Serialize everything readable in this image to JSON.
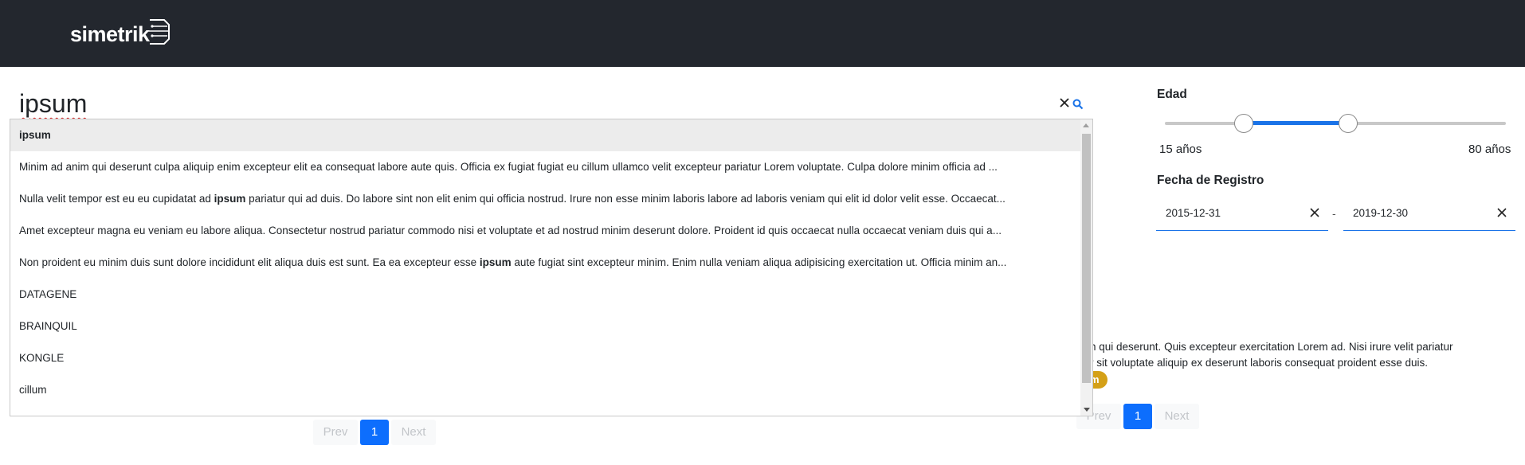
{
  "brand": {
    "logo_text": "simetrik"
  },
  "search": {
    "value": "ipsum"
  },
  "dropdown": {
    "items": [
      {
        "text": "ipsum",
        "active": true
      },
      {
        "parts": [
          "Minim ad anim qui deserunt culpa aliquip enim excepteur elit ea consequat labore aute quis. Officia ex fugiat fugiat eu cillum ullamco velit excepteur pariatur Lorem voluptate. Culpa dolore minim officia ad ..."
        ]
      },
      {
        "parts": [
          "Nulla velit tempor est eu eu cupidatat ad ",
          "ipsum",
          " pariatur qui ad duis. Do labore sint non elit enim qui officia nostrud. Irure non esse minim laboris labore ad laboris veniam qui elit id dolor velit esse. Occaecat..."
        ]
      },
      {
        "parts": [
          "Amet excepteur magna eu veniam eu labore aliqua. Consectetur nostrud pariatur commodo nisi et voluptate et ad nostrud minim deserunt dolore. Proident id quis occaecat nulla occaecat veniam duis qui a..."
        ]
      },
      {
        "parts": [
          "Non proident eu minim duis sunt dolore incididunt elit aliqua duis est sunt. Ea ea excepteur esse ",
          "ipsum",
          " aute fugiat sint excepteur minim. Enim nulla veniam aliqua adipisicing exercitation ut. Officia minim an..."
        ]
      },
      {
        "text": "DATAGENE"
      },
      {
        "text": "BRAINQUIL"
      },
      {
        "text": "KONGLE"
      },
      {
        "text": "cillum"
      }
    ]
  },
  "background_result": {
    "line1": "n qui deserunt. Quis excepteur exercitation Lorem ad. Nisi irure velit pariatur",
    "line2": "r sit voluptate aliquip ex deserunt laboris consequat proident esse duis.",
    "badge": "m"
  },
  "pagination_left": {
    "prev": "Prev",
    "page": "1",
    "next": "Next"
  },
  "pagination_right": {
    "prev": "Prev",
    "page": "1",
    "next": "Next"
  },
  "filters": {
    "age": {
      "label": "Edad",
      "min_label": "15 años",
      "max_label": "80 años"
    },
    "registration_date": {
      "label": "Fecha de Registro",
      "start": "2015-12-31",
      "separator": "-",
      "end": "2019-12-30"
    }
  },
  "colors": {
    "navbar": "#23272e",
    "accent": "#1a73e8",
    "badge": "#d4a017"
  }
}
